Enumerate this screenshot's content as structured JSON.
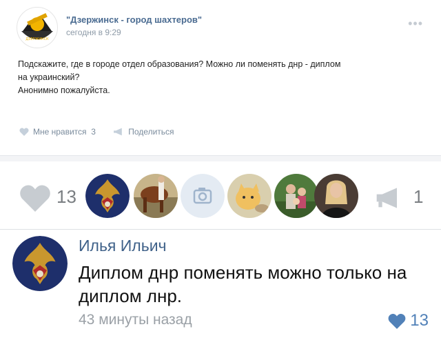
{
  "post": {
    "group_name": "\"Дзержинск - город шахтеров\"",
    "time": "сегодня в 9:29",
    "more_icon": "ellipsis-icon",
    "text_lines": [
      "Подскажите, где в городе отдел образования? Можно ли поменять днр - диплом",
      "на украинский?",
      "Анонимно пожалуйста."
    ],
    "actions": {
      "like_label": "Мне нравится",
      "like_count": "3",
      "share_label": "Поделиться"
    }
  },
  "reactions": {
    "likes_count": "13",
    "share_count": "1",
    "avatars": [
      "emblem-avatar",
      "horse-avatar",
      "camera-placeholder-avatar",
      "cat-avatar",
      "family-avatar",
      "woman-avatar"
    ]
  },
  "comment": {
    "author": "Илья Ильич",
    "text": "Диплом днр поменять можно только на диплом лнр.",
    "time": "43 минуты назад",
    "likes": "13"
  },
  "colors": {
    "link_blue": "#4a6b91",
    "like_blue": "#5181b8",
    "muted_grey": "#9aa0a6"
  }
}
